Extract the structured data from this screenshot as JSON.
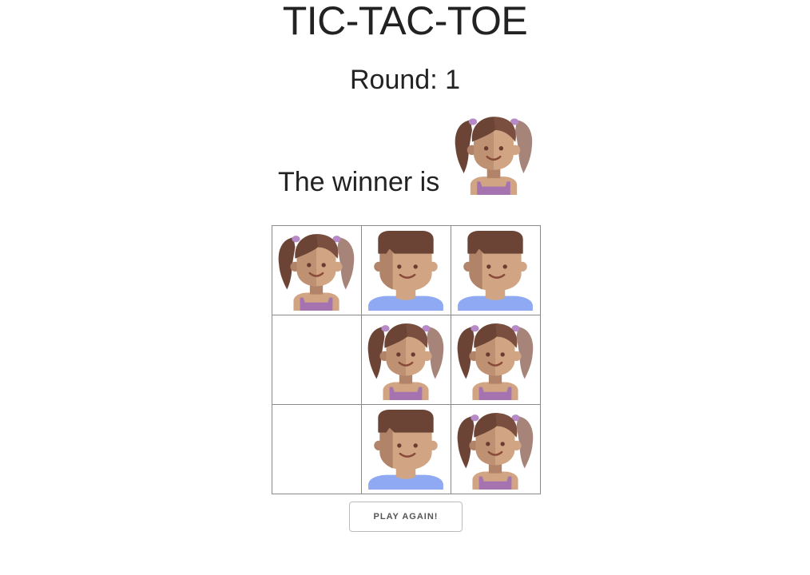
{
  "header": {
    "title": "TIC-TAC-TOE"
  },
  "status": {
    "round_label": "Round: 1",
    "winner_label": "The winner is",
    "winner_icon": "girl-avatar-icon"
  },
  "board": {
    "cells": [
      "girl",
      "boy",
      "boy",
      "",
      "girl",
      "girl",
      "",
      "boy",
      "girl"
    ]
  },
  "actions": {
    "play_again_label": "PLAY AGAIN!"
  },
  "colors": {
    "hair": "#6b4436",
    "hair_shadow": "#a78479",
    "skin": "#d1a583",
    "skin_shadow": "#b18369",
    "girl_top": "#a673b1",
    "boy_shirt": "#8faaf2",
    "mouth": "#8a4a3a",
    "clip": "#b58ac6",
    "cell_border": "#8a8a8a"
  }
}
